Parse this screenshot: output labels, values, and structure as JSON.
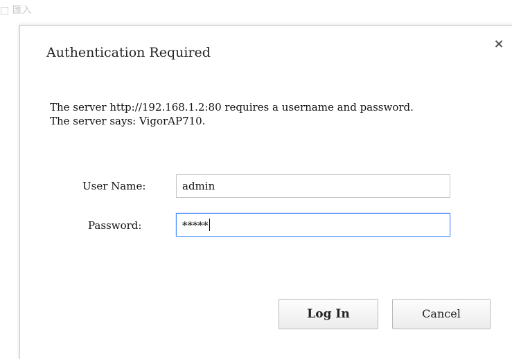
{
  "background": {
    "top_text": "□ 匯入"
  },
  "dialog": {
    "title": "Authentication Required",
    "close_icon": "close-icon",
    "message_line1": "The server http://192.168.1.2:80 requires a username and password.",
    "message_line2": "The server says: VigorAP710."
  },
  "form": {
    "username_label": "User Name:",
    "username_value": "admin",
    "password_label": "Password:",
    "password_value": "*****"
  },
  "buttons": {
    "login_label": "Log In",
    "cancel_label": "Cancel"
  },
  "colors": {
    "focus_border": "#4d90fe",
    "dialog_border": "#c9c9c9"
  }
}
